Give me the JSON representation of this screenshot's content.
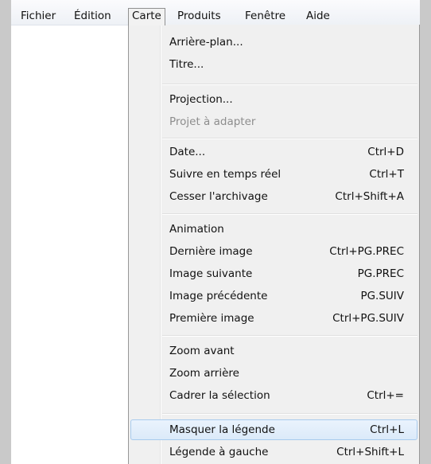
{
  "menubar": {
    "items": [
      {
        "label": "Fichier"
      },
      {
        "label": "Édition"
      },
      {
        "label": "Carte"
      },
      {
        "label": "Produits"
      },
      {
        "label": "Fenêtre"
      },
      {
        "label": "Aide"
      }
    ],
    "active": "Carte"
  },
  "menu": {
    "items": [
      {
        "label": "Arrière-plan...",
        "shortcut": ""
      },
      {
        "label": "Titre...",
        "shortcut": ""
      },
      {
        "label": "Projection...",
        "shortcut": ""
      },
      {
        "label": "Projet à adapter",
        "shortcut": "",
        "disabled": true
      },
      {
        "label": "Date...",
        "shortcut": "Ctrl+D"
      },
      {
        "label": "Suivre en temps réel",
        "shortcut": "Ctrl+T"
      },
      {
        "label": "Cesser l'archivage",
        "shortcut": "Ctrl+Shift+A"
      },
      {
        "label": "Animation",
        "shortcut": ""
      },
      {
        "label": "Dernière image",
        "shortcut": "Ctrl+PG.PREC"
      },
      {
        "label": "Image suivante",
        "shortcut": "PG.PREC"
      },
      {
        "label": "Image précédente",
        "shortcut": "PG.SUIV"
      },
      {
        "label": "Première image",
        "shortcut": "Ctrl+PG.SUIV"
      },
      {
        "label": "Zoom avant",
        "shortcut": ""
      },
      {
        "label": "Zoom arrière",
        "shortcut": ""
      },
      {
        "label": "Cadrer la sélection",
        "shortcut": "Ctrl+="
      },
      {
        "label": "Masquer la légende",
        "shortcut": "Ctrl+L",
        "highlighted": true
      },
      {
        "label": "Légende à gauche",
        "shortcut": "Ctrl+Shift+L"
      }
    ]
  },
  "colors": {
    "highlight_bg": "#dbeaf9",
    "highlight_border": "#a8cbee",
    "menu_bg": "#f0f0f0",
    "disabled_text": "#8d8d8d"
  }
}
